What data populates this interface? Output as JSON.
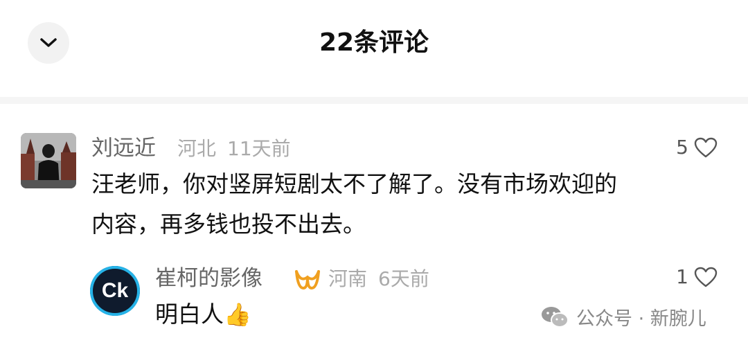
{
  "header": {
    "title": "22条评论",
    "collapse_icon": "chevron-down-icon"
  },
  "comments": [
    {
      "name": "刘远近",
      "location": "河北",
      "time": "11天前",
      "text_line1": "汪老师，你对竖屏短剧太不了解了。没有市场欢迎的",
      "text_line2": "内容，再多钱也投不出去。",
      "likes": "5"
    }
  ],
  "reply": {
    "name": "崔柯的影像",
    "avatar_text": "Ck",
    "badge_icon": "verified-badge-icon",
    "location": "河南",
    "time": "6天前",
    "text": "明白人",
    "emoji": "👍",
    "likes": "1"
  },
  "watermark": {
    "text": "公众号 · 新腕儿"
  },
  "colors": {
    "accent_ring": "#26b3e8",
    "badge": "#f0a020",
    "muted": "#aaaaaa"
  }
}
